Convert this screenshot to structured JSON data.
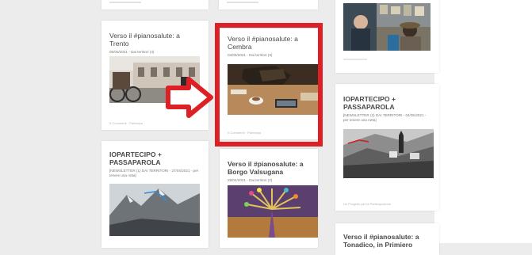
{
  "cards": {
    "trento": {
      "title": "Verso il #pianosalute: a Trento",
      "meta": "05/05/2021 - Dai territori (4)",
      "footer": "0 Commenti · Partecipa"
    },
    "cembra": {
      "title": "Verso il #pianosalute: a Cembra",
      "meta": "04/05/2021 - Dai territori (3)",
      "footer": "0 Commenti · Partecipa"
    },
    "borgo": {
      "title": "Verso il #pianosalute: a Borgo Valsugana",
      "meta": "28/04/2021 - Dai territori (2)"
    },
    "iopartecipo_left": {
      "title": "IOPARTECIPO + PASSAPAROLA",
      "meta": "[NEWSLETTER (1) DAI TERRITORI - 27/04/2021 - per tenere una rotta]"
    },
    "iopartecipo_right": {
      "title": "IOPARTECIPO + PASSAPAROLA",
      "meta": "[NEWSLETTER (2) DAI TERRITORI - 04/05/2021 - per tenere una rotta]",
      "footer": "Un Progetto per la Partecipazione"
    },
    "tonadico": {
      "title": "Verso il #pianosalute: a Tonadico, in Primiero"
    }
  },
  "colors": {
    "highlight": "#dd1f26",
    "arrow": "#dd1f26",
    "background": "#ececec",
    "card": "#ffffff"
  }
}
